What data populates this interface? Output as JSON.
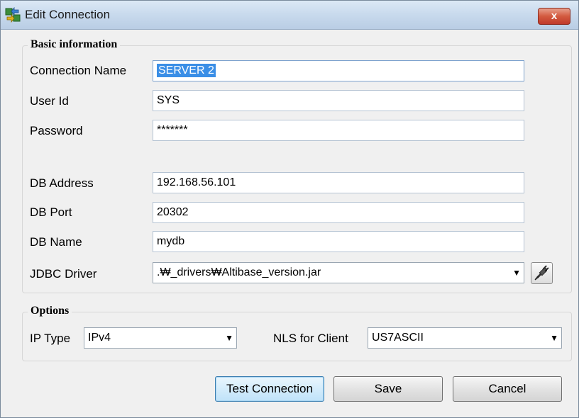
{
  "window": {
    "title": "Edit Connection",
    "close_label": "x"
  },
  "basic": {
    "legend": "Basic information",
    "connection_name": {
      "label": "Connection Name",
      "value": "SERVER 2"
    },
    "user_id": {
      "label": "User Id",
      "value": "SYS"
    },
    "password": {
      "label": "Password",
      "value": "*******"
    },
    "db_address": {
      "label": "DB Address",
      "value": "192.168.56.101"
    },
    "db_port": {
      "label": "DB Port",
      "value": "20302"
    },
    "db_name": {
      "label": "DB Name",
      "value": "mydb"
    },
    "jdbc_driver": {
      "label": "JDBC Driver",
      "value": ".₩_drivers₩Altibase_version.jar"
    }
  },
  "options": {
    "legend": "Options",
    "ip_type": {
      "label": "IP Type",
      "value": "IPv4"
    },
    "nls": {
      "label": "NLS for Client",
      "value": "US7ASCII"
    }
  },
  "buttons": {
    "test": "Test Connection",
    "save": "Save",
    "cancel": "Cancel"
  },
  "colors": {
    "selection": "#3a8ee6",
    "close": "#c0392b",
    "titlebar": "#c6d8ec"
  }
}
